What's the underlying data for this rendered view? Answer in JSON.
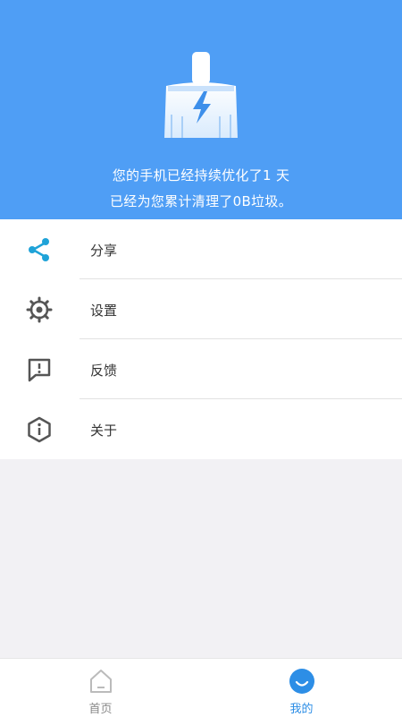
{
  "header": {
    "line1": "您的手机已经持续优化了1 天",
    "line2": "已经为您累计清理了0B垃圾。",
    "icon": "broom-lightning-icon",
    "bg_color": "#4f9ef5"
  },
  "menu": {
    "items": [
      {
        "label": "分享",
        "icon": "share-icon"
      },
      {
        "label": "设置",
        "icon": "gear-icon"
      },
      {
        "label": "反馈",
        "icon": "feedback-icon"
      },
      {
        "label": "关于",
        "icon": "info-icon"
      }
    ]
  },
  "tabbar": {
    "tabs": [
      {
        "label": "首页",
        "icon": "home-icon",
        "active": false
      },
      {
        "label": "我的",
        "icon": "profile-icon",
        "active": true
      }
    ],
    "active_color": "#2d8ee6",
    "inactive_color": "#888888"
  }
}
